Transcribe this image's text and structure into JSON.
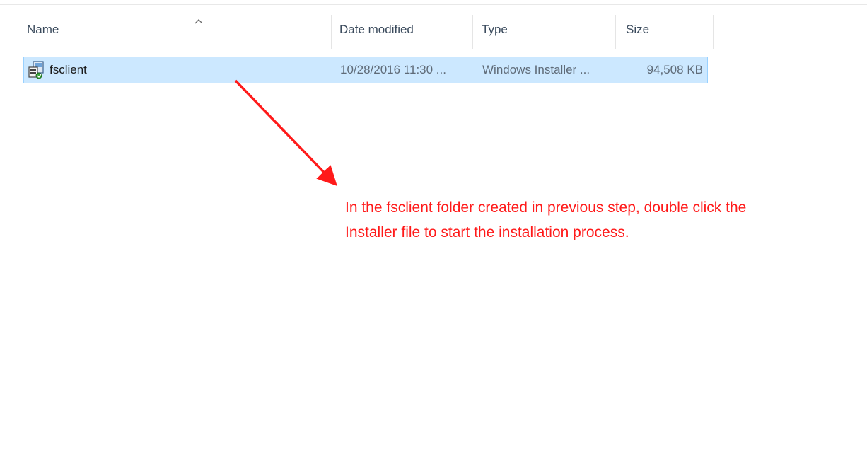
{
  "columns": {
    "name": "Name",
    "date_modified": "Date modified",
    "type": "Type",
    "size": "Size"
  },
  "sort": {
    "column": "name",
    "direction": "ascending",
    "icon": "chevron-up-icon"
  },
  "files": [
    {
      "icon": "windows-installer-icon",
      "name": "fsclient",
      "date_modified": "10/28/2016 11:30 ...",
      "type": "Windows Installer ...",
      "size": "94,508 KB",
      "selected": true
    }
  ],
  "annotation": {
    "line1": "In the fsclient folder created in previous step, double click the",
    "line2": "Installer file to start the installation process.",
    "color": "#ff1a1a",
    "icon": "red-arrow-icon"
  },
  "colors": {
    "selection_fill": "#cce8ff",
    "selection_border": "#99d1ff"
  }
}
